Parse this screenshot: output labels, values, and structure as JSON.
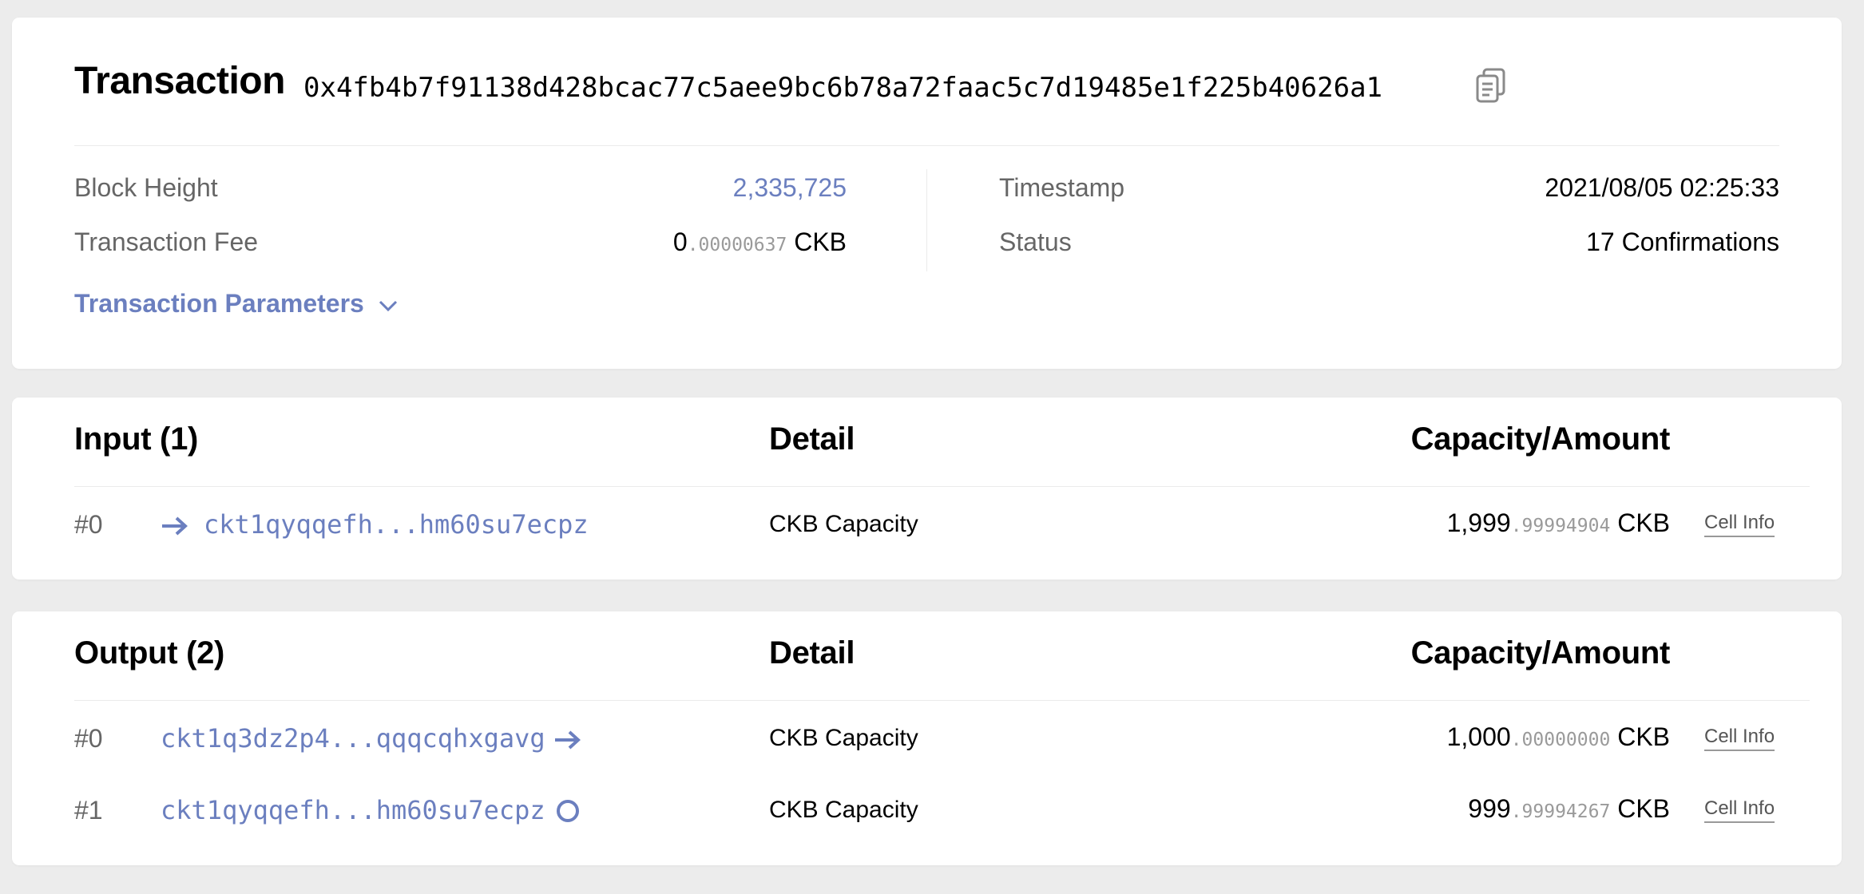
{
  "transaction": {
    "title": "Transaction",
    "hash": "0x4fb4b7f91138d428bcac77c5aee9bc6b78a72faac5c7d19485e1f225b40626a1",
    "block_height_label": "Block Height",
    "block_height": "2,335,725",
    "fee_label": "Transaction Fee",
    "fee_int": "0",
    "fee_dec": ".00000637",
    "fee_unit": "CKB",
    "timestamp_label": "Timestamp",
    "timestamp": "2021/08/05 02:25:33",
    "status_label": "Status",
    "status": "17 Confirmations",
    "params_label": "Transaction Parameters"
  },
  "input": {
    "header": "Input (1)",
    "detail_header": "Detail",
    "amount_header": "Capacity/Amount",
    "rows": [
      {
        "index": "#0",
        "address": "ckt1qyqqefh...hm60su7ecpz",
        "detail": "CKB Capacity",
        "amount_int": "1,999",
        "amount_dec": ".99994904",
        "unit": "CKB",
        "cell_info": "Cell Info"
      }
    ]
  },
  "output": {
    "header": "Output (2)",
    "detail_header": "Detail",
    "amount_header": "Capacity/Amount",
    "rows": [
      {
        "index": "#0",
        "address": "ckt1q3dz2p4...qqqcqhxgavg",
        "detail": "CKB Capacity",
        "amount_int": "1,000",
        "amount_dec": ".00000000",
        "unit": "CKB",
        "cell_info": "Cell Info"
      },
      {
        "index": "#1",
        "address": "ckt1qyqqefh...hm60su7ecpz",
        "detail": "CKB Capacity",
        "amount_int": "999",
        "amount_dec": ".99994267",
        "unit": "CKB",
        "cell_info": "Cell Info"
      }
    ]
  },
  "colors": {
    "accent": "#6b7fbf",
    "background": "#ececec",
    "card": "#ffffff",
    "label": "#666666"
  },
  "icons": [
    "copy-icon",
    "chevron-down-icon",
    "arrow-right-icon",
    "live-cell-circle-icon"
  ]
}
